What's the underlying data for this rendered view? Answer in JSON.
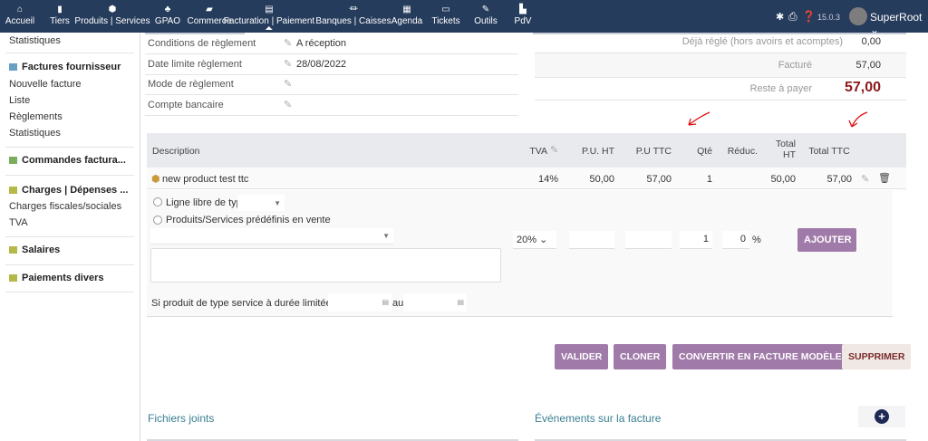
{
  "nav": {
    "items": [
      {
        "label": "Accueil",
        "icon": "home-icon",
        "glyph": "⌂"
      },
      {
        "label": "Tiers",
        "icon": "building-icon",
        "glyph": "▮"
      },
      {
        "label": "Produits | Services",
        "icon": "cube-icon",
        "glyph": "⬢"
      },
      {
        "label": "GPAO",
        "icon": "cubes-icon",
        "glyph": "♣"
      },
      {
        "label": "Commerce",
        "icon": "briefcase-icon",
        "glyph": "▰"
      },
      {
        "label": "Facturation | Paiement",
        "icon": "money-icon",
        "glyph": "▤"
      },
      {
        "label": "Banques | Caisses",
        "icon": "bank-icon",
        "glyph": "⏛"
      },
      {
        "label": "Agenda",
        "icon": "calendar-icon",
        "glyph": "▦"
      },
      {
        "label": "Tickets",
        "icon": "ticket-icon",
        "glyph": "▭"
      },
      {
        "label": "Outils",
        "icon": "wrench-icon",
        "glyph": "✎"
      },
      {
        "label": "PdV",
        "icon": "cash-register-icon",
        "glyph": "▙"
      }
    ],
    "version": "15.0.3",
    "user": "SuperRoot"
  },
  "sidebar": {
    "top": "Statistiques",
    "supplier_invoices": {
      "title": "Factures fournisseur",
      "items": [
        "Nouvelle facture",
        "Liste",
        "Règlements",
        "Statistiques"
      ]
    },
    "orders": "Commandes factura...",
    "charges": {
      "title": "Charges | Dépenses ...",
      "items": [
        "Charges fiscales/sociales",
        "TVA"
      ]
    },
    "salaries": "Salaires",
    "misc": "Paiements divers"
  },
  "info": {
    "rows": [
      {
        "label": "Conditions de règlement",
        "value": "A réception"
      },
      {
        "label": "Date limite règlement",
        "value": "28/08/2022"
      },
      {
        "label": "Mode de règlement",
        "value": ""
      },
      {
        "label": "Compte bancaire",
        "value": ""
      }
    ],
    "paid_label": "Déjà réglé (hors avoirs et acomptes)",
    "paid": "0,00",
    "billed_label": "Facturé",
    "billed": "57,00",
    "remaining_label": "Reste à payer",
    "remaining": "57,00"
  },
  "table": {
    "headers": {
      "description": "Description",
      "vat": "TVA",
      "pu_ht": "P.U. HT",
      "pu_ttc": "P.U TTC",
      "qty": "Qté",
      "discount": "Réduc.",
      "total_ht_1": "Total",
      "total_ht_2": "HT",
      "total_ttc": "Total TTC"
    },
    "line": {
      "description": "new product test ttc",
      "vat": "14%",
      "pu_ht": "50,00",
      "pu_ttc": "57,00",
      "qty": "1",
      "total_ht": "50,00",
      "total_ttc": "57,00"
    }
  },
  "add": {
    "free_line": "Ligne libre de type",
    "predefined": "Produits/Services prédéfinis en vente",
    "vat": "20%",
    "qty": "1",
    "discount": "0",
    "pct": "%",
    "add_button": "AJOUTER",
    "service_label": "Si produit de type service à durée limitée : Du",
    "to": "au"
  },
  "actions": {
    "validate": "VALIDER",
    "clone": "CLONER",
    "convert": "CONVERTIR EN FACTURE MODÈLE",
    "delete": "SUPPRIMER"
  },
  "sections": {
    "files": "Fichiers joints",
    "events": "Événements sur la facture"
  }
}
